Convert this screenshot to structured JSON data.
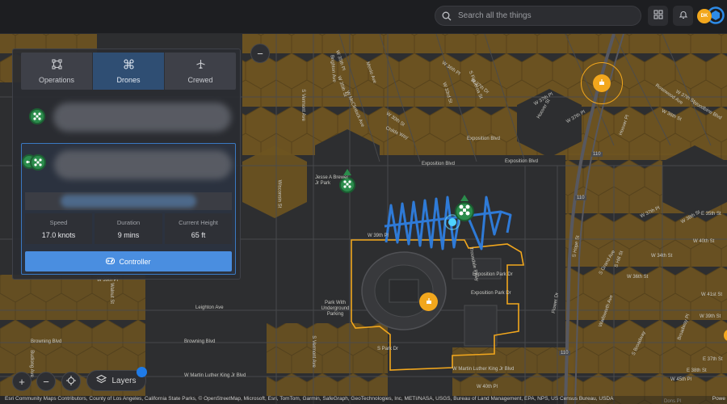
{
  "search": {
    "placeholder": "Search all the things"
  },
  "user": {
    "initials": "DK"
  },
  "panel": {
    "tabs": [
      {
        "label": "Operations"
      },
      {
        "label": "Drones"
      },
      {
        "label": "Crewed"
      }
    ],
    "selected_drone": {
      "stats": [
        {
          "label": "Speed",
          "value": "17.0 knots"
        },
        {
          "label": "Duration",
          "value": "9 mins"
        },
        {
          "label": "Current Height",
          "value": "65 ft"
        }
      ],
      "controller_label": "Controller"
    }
  },
  "map_controls": {
    "layers_label": "Layers"
  },
  "map": {
    "streets": [
      "W 35th Pl",
      "W 36th Pl",
      "W 37th Pl",
      "W 35th St",
      "W 36th St",
      "W 37th St",
      "S Vermont Ave",
      "W McClintock Ave",
      "W 30th St",
      "Exposition Blvd",
      "Exposition Blvd",
      "Exposition Blvd",
      "Trousdale Pkwy",
      "Childs Way",
      "Exposition Park Dr",
      "Exposition Park Dr",
      "Jesse A Brewer Jr Park",
      "Park With Underground Parking",
      "W 39th Pl",
      "S Park Dr",
      "Leighton Ave",
      "Browning Blvd",
      "Browning Blvd",
      "W Martin Luther King Jr Blvd",
      "W Martin Luther King Jr Blvd",
      "W 40th Pl",
      "Wisconsin St",
      "S Vermont Ave",
      "S Figueroa St",
      "Flower Dr",
      "S Grand Ave",
      "Wadsworth Ave",
      "Hoover St",
      "W 37th Pl",
      "W 38th St",
      "W 39th St",
      "W 34th St",
      "W 36th St",
      "Broadway Pl",
      "S Broadway",
      "Brighton Ave",
      "Menlo Ave",
      "W 39th Pl",
      "W 37th Dr",
      "Rosewood Ave",
      "Walnut St",
      "Budlong Ave",
      "S Hill St",
      "E 37th St",
      "E 38th St",
      "Hoover Pl",
      "W 33rd St",
      "Woodbine Blvd",
      "S Hope St",
      "Dons Pl",
      "110",
      "110",
      "110",
      "W 45th Pl",
      "W 37th Pl",
      "W 40th St",
      "W 41st St",
      "W Exposition Blvd",
      "E 35th St"
    ],
    "attribution": "Esri Community Maps Contributors, County of Los Angeles, California State Parks, © OpenStreetMap, Microsoft, Esri, TomTom, Garmin, SafeGraph, GeoTechnologies, Inc, METI/NASA, USGS, Bureau of Land Management, EPA, NPS, US Census Bureau, USDA",
    "powered_by": "Powe"
  },
  "colors": {
    "hex_fill": "#6e5420",
    "boundary": "#f2a71d",
    "flight_path": "#2f7fe0",
    "drone": "#2b8c4c",
    "accent": "#4a8ee0"
  }
}
